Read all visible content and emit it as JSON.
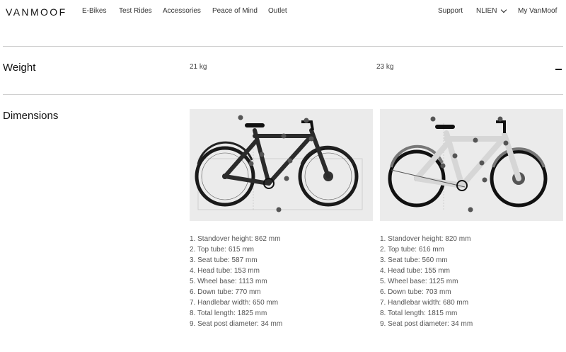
{
  "header": {
    "logo": "VANMOOF",
    "nav": [
      "E-Bikes",
      "Test Rides",
      "Accessories",
      "Peace of Mind",
      "Outlet"
    ],
    "support": "Support",
    "language": "NLIEN",
    "account": "My VanMoof"
  },
  "weight": {
    "title": "Weight",
    "values": [
      "21 kg",
      "23 kg"
    ]
  },
  "dimensions": {
    "title": "Dimensions",
    "bike1": [
      "1. Standover height: 862 mm",
      "2. Top tube: 615 mm",
      "3. Seat tube: 587 mm",
      "4. Head tube: 153 mm",
      "5. Wheel base: 1113 mm",
      "6. Down tube: 770 mm",
      "7. Handlebar width: 650 mm",
      "8. Total length: 1825 mm",
      "9. Seat post diameter: 34 mm"
    ],
    "bike2": [
      "1. Standover height: 820 mm",
      "2. Top tube: 616 mm",
      "3. Seat tube: 560 mm",
      "4. Head tube: 155 mm",
      "5. Wheel base: 1125 mm",
      "6. Down tube: 703 mm",
      "7. Handlebar width: 680 mm",
      "8. Total length: 1815 mm",
      "9. Seat post diameter: 34 mm"
    ]
  },
  "colors": {
    "bike1_frame": "#2b2b2b",
    "bike2_frame": "#cfcfcf",
    "image_bg": "#ebebeb"
  }
}
